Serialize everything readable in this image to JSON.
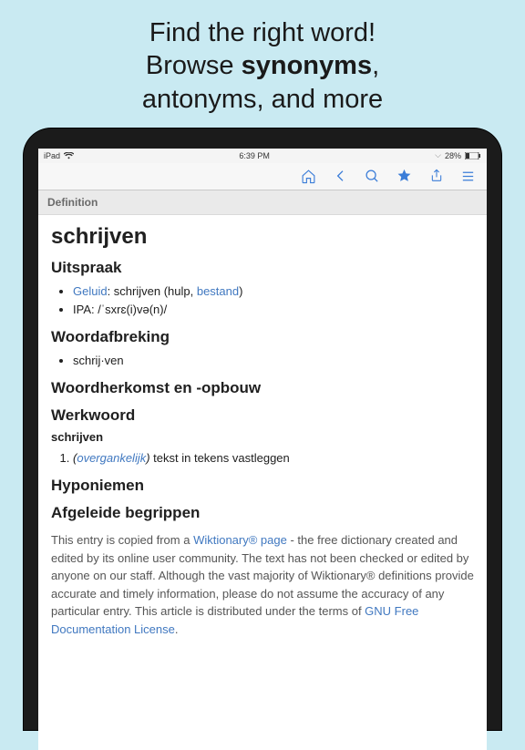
{
  "promo": {
    "line1": "Find the right word!",
    "line2_prefix": "Browse ",
    "line2_bold": "synonyms",
    "line2_suffix": ",",
    "line3": "antonyms, and more"
  },
  "statusbar": {
    "carrier": "iPad",
    "time": "6:39 PM",
    "battery": "28%"
  },
  "toolbar": {
    "icons": [
      "home",
      "back",
      "search",
      "star",
      "share",
      "menu"
    ]
  },
  "section_label": "Definition",
  "entry": {
    "headword": "schrijven",
    "sections": {
      "uitspraak": {
        "title": "Uitspraak",
        "bullets": {
          "geluid_link": "Geluid",
          "geluid_text": ": schrijven (hulp, ",
          "bestand_link": "bestand",
          "geluid_close": ")",
          "ipa": "IPA: /ˈsxrɛ(i)və(n)/"
        }
      },
      "woordafbreking": {
        "title": "Woordafbreking",
        "bullet": "schrij·ven"
      },
      "woordherkomst": {
        "title": "Woordherkomst en -opbouw"
      },
      "werkwoord": {
        "title": "Werkwoord",
        "sub": "schrijven",
        "def_link": "overgankelijk",
        "def_text": " tekst in tekens vastleggen"
      },
      "hyponiemen": {
        "title": "Hyponiemen"
      },
      "afgeleide": {
        "title": "Afgeleide begrippen"
      }
    },
    "footer": {
      "t1": "This entry is copied from a ",
      "wlink": "Wiktionary® page",
      "t2": " - the free dictionary created and edited by its online user community. The text has not been checked or edited by anyone on our staff. Although the vast majority of Wiktionary® definitions provide accurate and timely information, please do not assume the accuracy of any particular entry. This article is distributed under the terms of ",
      "llink": "GNU Free Documentation License",
      "t3": "."
    }
  }
}
